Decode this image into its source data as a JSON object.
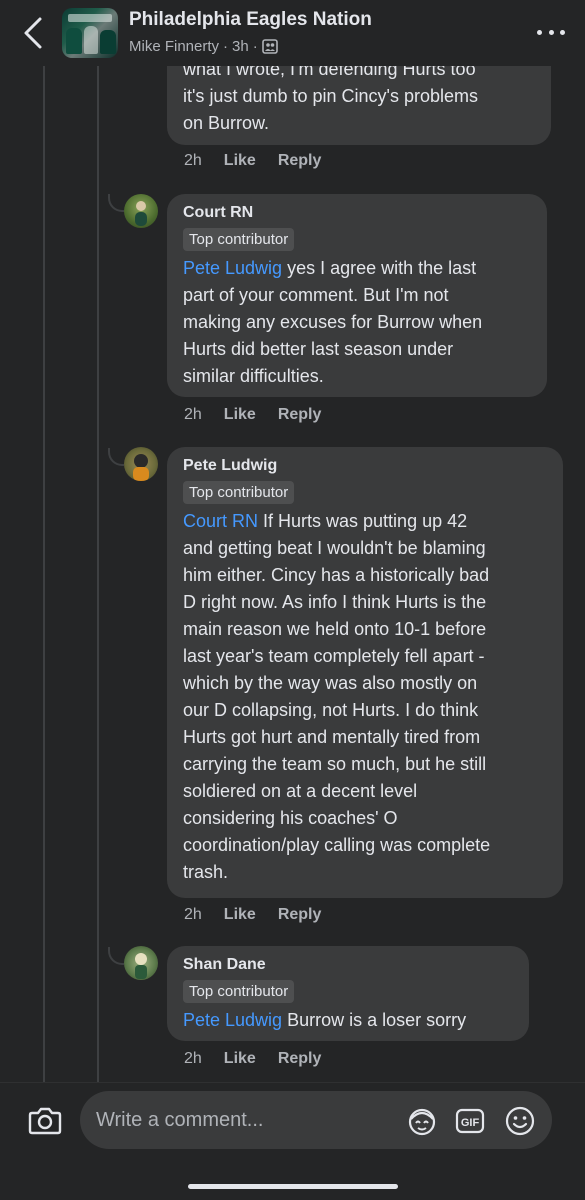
{
  "header": {
    "group_name": "Philadelphia Eagles Nation",
    "author": "Mike Finnerty",
    "time": "3h",
    "separator": "·"
  },
  "partial_comment": {
    "text_line1": "what I wrote, I'm defending Hurts too",
    "text_line2": "it's just dumb to pin Cincy's problems",
    "text_line3": "on Burrow.",
    "time": "2h",
    "like": "Like",
    "reply": "Reply"
  },
  "comments": [
    {
      "author": "Court RN",
      "badge": "Top contributor",
      "mention": "Pete Ludwig",
      "lines": [
        " yes I agree with the last",
        "part of your comment. But I'm not",
        "making any excuses for Burrow when",
        "Hurts did better last season under",
        "similar difficulties."
      ],
      "time": "2h",
      "like": "Like",
      "reply": "Reply"
    },
    {
      "author": "Pete Ludwig",
      "badge": "Top contributor",
      "mention": "Court RN",
      "lines": [
        " If Hurts was putting up 42",
        "and getting beat I wouldn't be blaming",
        "him either.  Cincy has a historically bad",
        "D right now.  As info I think Hurts is the",
        "main reason we held onto 10-1 before",
        "last year's team completely fell apart -",
        "which by the way was also mostly on",
        "our D collapsing, not Hurts.  I do think",
        "Hurts got hurt and mentally tired from",
        "carrying the team so much, but he still",
        "soldiered on at a decent level",
        "considering his coaches' O",
        "coordination/play calling was complete",
        "trash."
      ],
      "time": "2h",
      "like": "Like",
      "reply": "Reply"
    },
    {
      "author": "Shan Dane",
      "badge": "Top contributor",
      "mention": "Pete Ludwig",
      "lines": [
        " Burrow is a loser sorry"
      ],
      "time": "2h",
      "like": "Like",
      "reply": "Reply"
    }
  ],
  "composer": {
    "placeholder": "Write a comment..."
  },
  "icons": {
    "back": "chevron-left-icon",
    "more": "more-icon",
    "group_privacy": "group-icon",
    "camera": "camera-icon",
    "avatar_sticker": "avatar-sticker-icon",
    "gif": "gif-icon",
    "emoji": "emoji-icon"
  },
  "colors": {
    "background": "#242526",
    "bubble": "#3a3b3c",
    "mention": "#4599ff",
    "secondary_text": "#b0b3b8"
  }
}
